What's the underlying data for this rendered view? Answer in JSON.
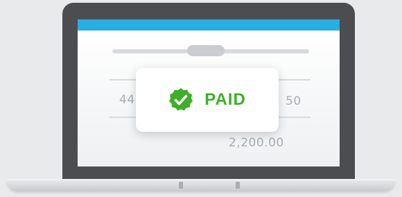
{
  "invoice": {
    "cell_left": "44",
    "cell_right": "50",
    "total": "2,200.00"
  },
  "status": {
    "label": "PAID",
    "icon": "check-badge-icon",
    "color": "#3fae2a"
  },
  "colors": {
    "header_bar": "#29aee2",
    "laptop_frame": "#4b4d51"
  }
}
